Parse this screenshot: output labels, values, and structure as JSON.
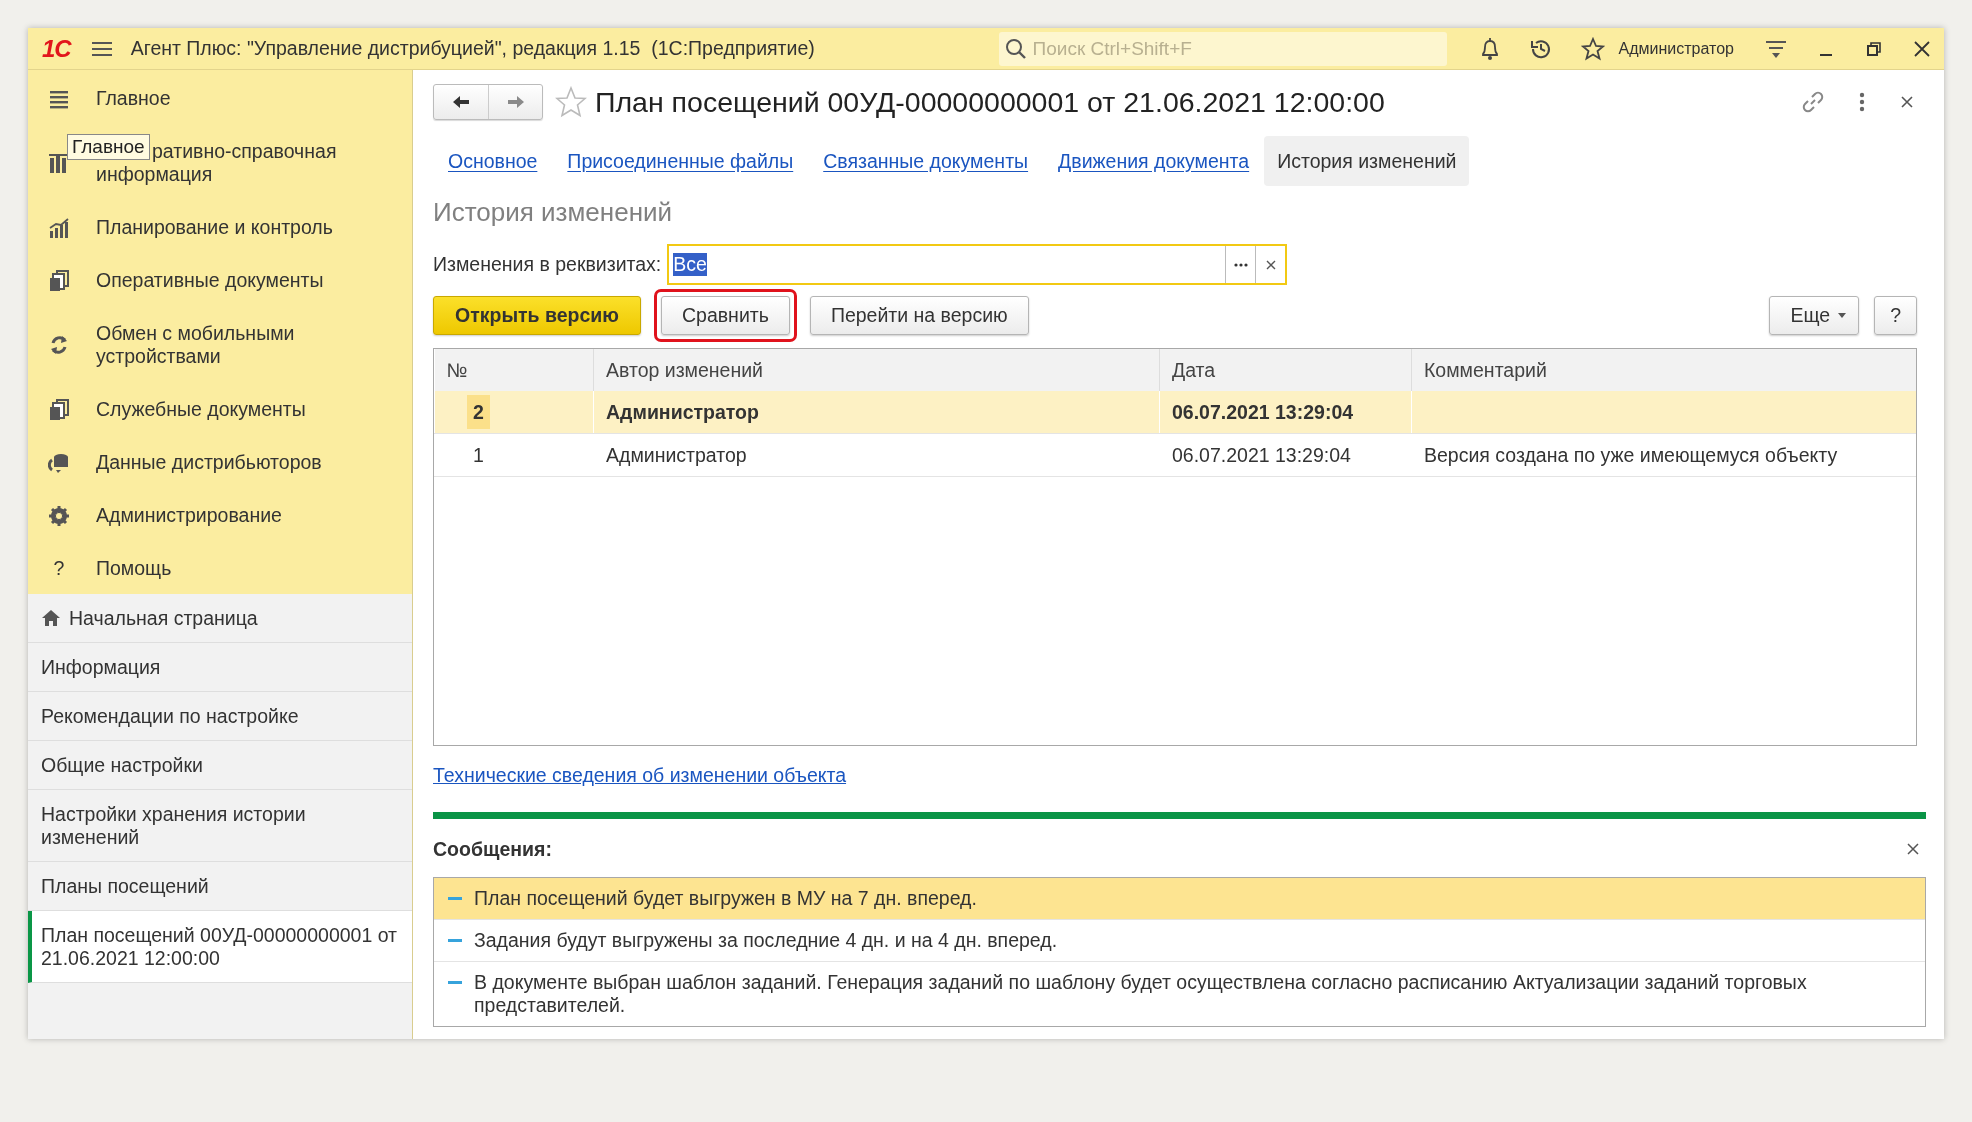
{
  "window": {
    "logo": "1С",
    "title": "Агент Плюс: \"Управление дистрибуцией\", редакция 1.15  (1С:Предприятие)",
    "search": {
      "placeholder": "Поиск Ctrl+Shift+F"
    },
    "user": "Администратор"
  },
  "sidebar": {
    "sections": [
      {
        "kind": "menu",
        "label": "Главное"
      },
      {
        "kind": "books",
        "label_lines": [
          "ративно-справочная",
          "информация"
        ],
        "tooltip": "Главное"
      },
      {
        "kind": "chart",
        "label": "Планирование и контроль"
      },
      {
        "kind": "docs",
        "label": "Оперативные документы"
      },
      {
        "kind": "sync",
        "label": "Обмен с мобильными устройствами"
      },
      {
        "kind": "docs",
        "label": "Служебные документы"
      },
      {
        "kind": "db",
        "label": "Данные дистрибьюторов"
      },
      {
        "kind": "gear",
        "label": "Администрирование"
      },
      {
        "kind": "help",
        "icon": "?",
        "label": "Помощь"
      }
    ],
    "pages": [
      {
        "kind": "home",
        "label": "Начальная страница",
        "selected": false
      },
      {
        "kind": "plain",
        "label": "Информация",
        "selected": false
      },
      {
        "kind": "plain",
        "label": "Рекомендации по настройке",
        "selected": false
      },
      {
        "kind": "plain",
        "label": "Общие настройки",
        "selected": false
      },
      {
        "kind": "plain",
        "label": "Настройки хранения истории изменений",
        "selected": false
      },
      {
        "kind": "plain",
        "label": "Планы посещений",
        "selected": false
      },
      {
        "kind": "plain",
        "label": "План посещений 00УД-00000000001 от 21.06.2021 12:00:00",
        "selected": true
      }
    ]
  },
  "document": {
    "title": "План посещений 00УД-00000000001 от 21.06.2021 12:00:00",
    "tabs": [
      {
        "label": "Основное",
        "selected": false
      },
      {
        "label": "Присоединенные файлы",
        "selected": false
      },
      {
        "label": "Связанные документы",
        "selected": false
      },
      {
        "label": "Движения документа",
        "selected": false
      },
      {
        "label": "История изменений",
        "selected": true
      }
    ],
    "section_title": "История изменений",
    "filter": {
      "label": "Изменения в реквизитах:",
      "value": "Все",
      "value_selected": true
    },
    "buttons": [
      {
        "kind": "primary",
        "label": "Открыть версию",
        "highlighted": false
      },
      {
        "kind": "default",
        "label": "Сравнить",
        "highlighted": true
      },
      {
        "kind": "default",
        "label": "Перейти на версию",
        "highlighted": false
      }
    ],
    "more_button": "Еще",
    "help_button": "?",
    "table": {
      "columns": [
        "№",
        "Автор изменений",
        "Дата",
        "Комментарий"
      ],
      "rows": [
        {
          "number": "2",
          "author": "Администратор",
          "date": "06.07.2021 13:29:04",
          "selected": true
        },
        {
          "number": "1",
          "author": "Администратор",
          "date": "06.07.2021 13:29:04",
          "comment": "Версия создана по уже имеющемуся объекту",
          "selected": false
        }
      ]
    },
    "link": "Технические сведения об изменении объекта"
  },
  "messages": {
    "title": "Сообщения:",
    "items": [
      {
        "text": "План посещений будет выгружен в МУ на 7 дн. вперед.",
        "selected": true
      },
      {
        "text": "Задания будут выгружены за последние 4 дн. и на 4 дн. вперед.",
        "selected": false
      },
      {
        "text": "В документе выбран шаблон заданий. Генерация заданий по шаблону будет осуществлена согласно расписанию Актуализации заданий торговых представителей.",
        "selected": false
      }
    ]
  }
}
